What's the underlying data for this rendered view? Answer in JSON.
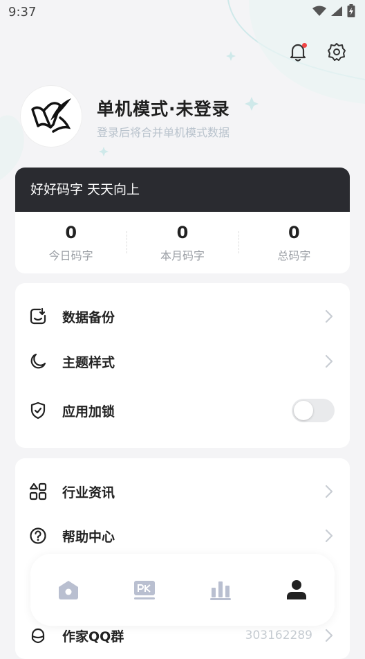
{
  "status_bar": {
    "time": "9:37"
  },
  "profile": {
    "name": "单机模式·未登录",
    "subtitle": "登录后将合并单机模式数据"
  },
  "stats": {
    "banner": "好好码字 天天向上",
    "items": [
      {
        "value": "0",
        "label": "今日码字"
      },
      {
        "value": "0",
        "label": "本月码字"
      },
      {
        "value": "0",
        "label": "总码字"
      }
    ]
  },
  "menu_group1": [
    {
      "label": "数据备份",
      "icon": "backup-icon"
    },
    {
      "label": "主题样式",
      "icon": "moon-icon"
    },
    {
      "label": "应用加锁",
      "icon": "shield-check-icon",
      "toggle_on": false
    }
  ],
  "menu_group2": [
    {
      "label": "行业资讯",
      "icon": "grid-icon"
    },
    {
      "label": "帮助中心",
      "icon": "help-icon"
    },
    {
      "label": "作家QQ群",
      "icon": "qq-icon",
      "value": "303162289"
    }
  ],
  "bottom_nav": [
    {
      "name": "home",
      "icon": "home-icon",
      "active": false
    },
    {
      "name": "pk",
      "icon": "pk-icon",
      "active": false
    },
    {
      "name": "stats",
      "icon": "bar-chart-icon",
      "active": false
    },
    {
      "name": "profile",
      "icon": "person-icon",
      "active": true
    }
  ],
  "colors": {
    "background": "#f4f4f6",
    "banner": "#2a2b30",
    "accent_dot": "#f04444",
    "nav_inactive": "#b9bfd0",
    "nav_active": "#222222"
  }
}
